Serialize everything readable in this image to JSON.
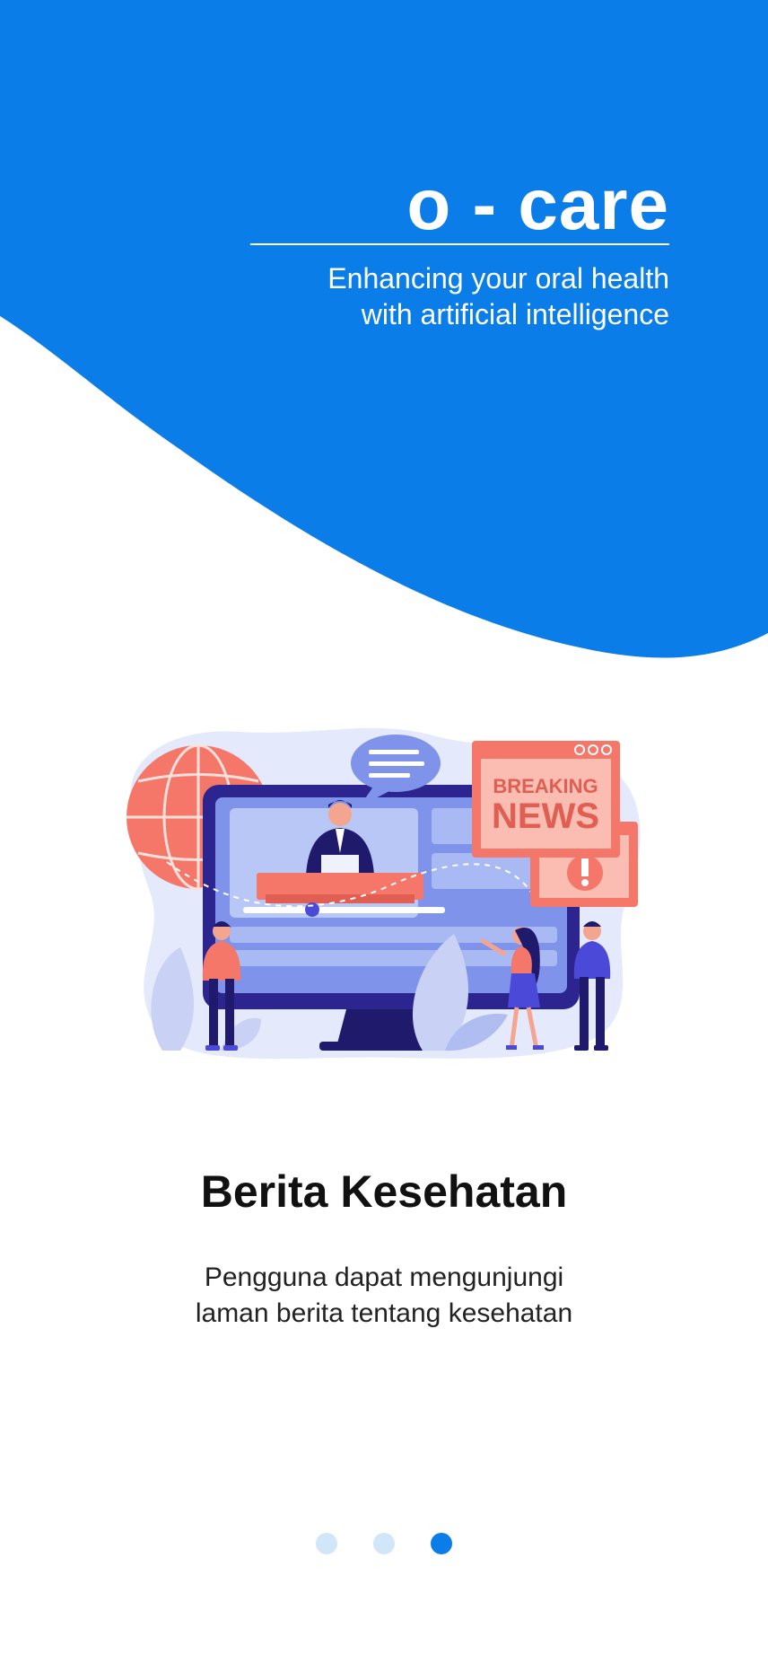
{
  "app": {
    "title": "o - care",
    "tagline_line1": "Enhancing your oral health",
    "tagline_line2": "with artificial intelligence"
  },
  "illustration": {
    "sign_line1": "BREAKING",
    "sign_line2": "NEWS"
  },
  "feature": {
    "title": "Berita Kesehatan",
    "desc_line1": "Pengguna dapat mengunjungi",
    "desc_line2": "laman berita tentang kesehatan"
  },
  "pager": {
    "pages": 3,
    "current": 3
  },
  "colors": {
    "primary": "#0a7de8",
    "dot_inactive": "#d2e6fa",
    "coral": "#f4776a",
    "navy": "#1f1a6b"
  }
}
